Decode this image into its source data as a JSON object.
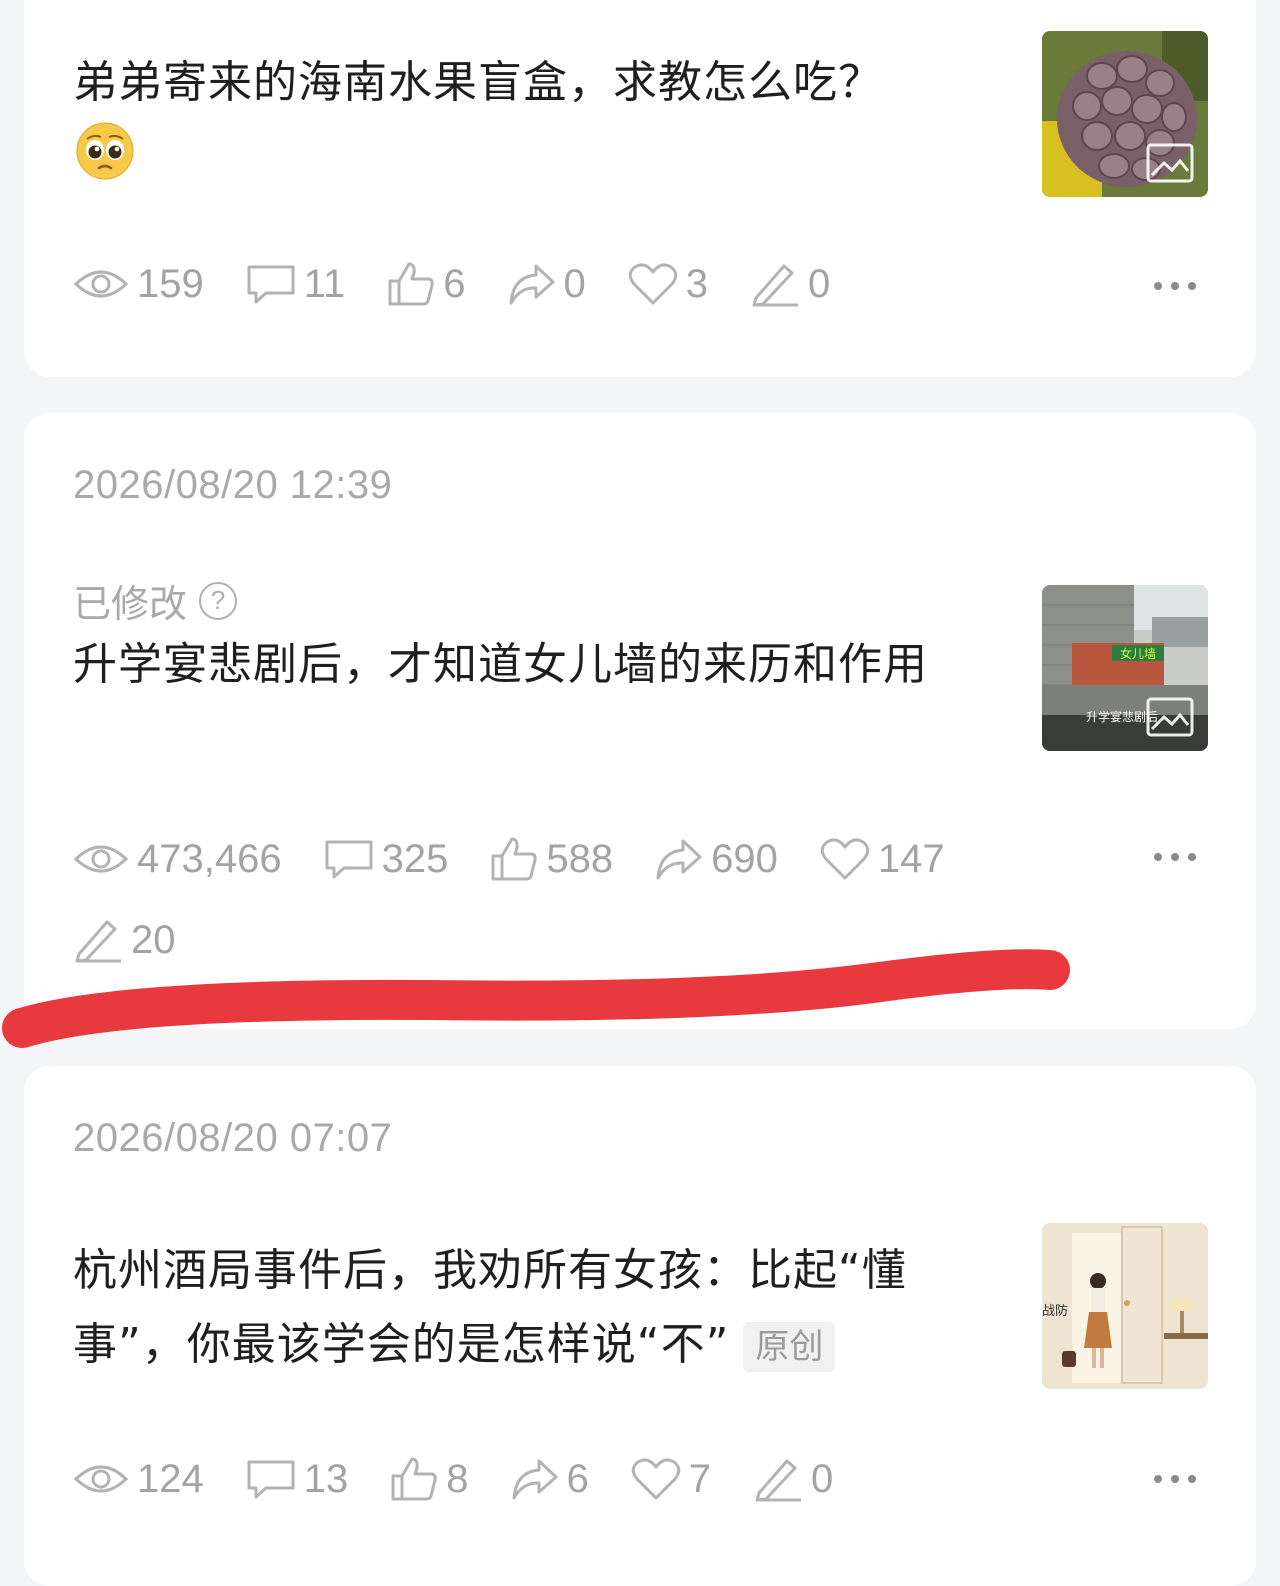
{
  "posts": [
    {
      "title": "弟弟寄来的海南水果盲盒，求教怎么吃？",
      "emoji": "pleading-face",
      "thumbnail": "custard-apple-fruit-photo",
      "stats": {
        "views": "159",
        "comments": "11",
        "likes": "6",
        "shares": "0",
        "favorites": "3",
        "edits": "0"
      }
    },
    {
      "date": "2026/08/20 12:39",
      "modified_label": "已修改",
      "title": "升学宴悲剧后，才知道女儿墙的来历和作用",
      "thumbnail": "rooftop-parapet-wall-photo",
      "thumbnail_text": {
        "tag": "女儿墙",
        "caption": "升学宴悲剧后"
      },
      "stats": {
        "views": "473,466",
        "comments": "325",
        "likes": "588",
        "shares": "690",
        "favorites": "147",
        "edits": "20"
      }
    },
    {
      "date": "2026/08/20 07:07",
      "title": "杭州酒局事件后，我劝所有女孩：比起“懂事”，你最该学会的是怎样说“不”",
      "tag": "原创",
      "thumbnail": "woman-at-door-illustration",
      "thumbnail_text": {
        "side": "战防"
      },
      "stats": {
        "views": "124",
        "comments": "13",
        "likes": "8",
        "shares": "6",
        "favorites": "7",
        "edits": "0"
      }
    }
  ],
  "colors": {
    "annotation": "#e8393f",
    "muted": "#a3a3a3",
    "card": "#ffffff",
    "background": "#f4f5f7"
  }
}
